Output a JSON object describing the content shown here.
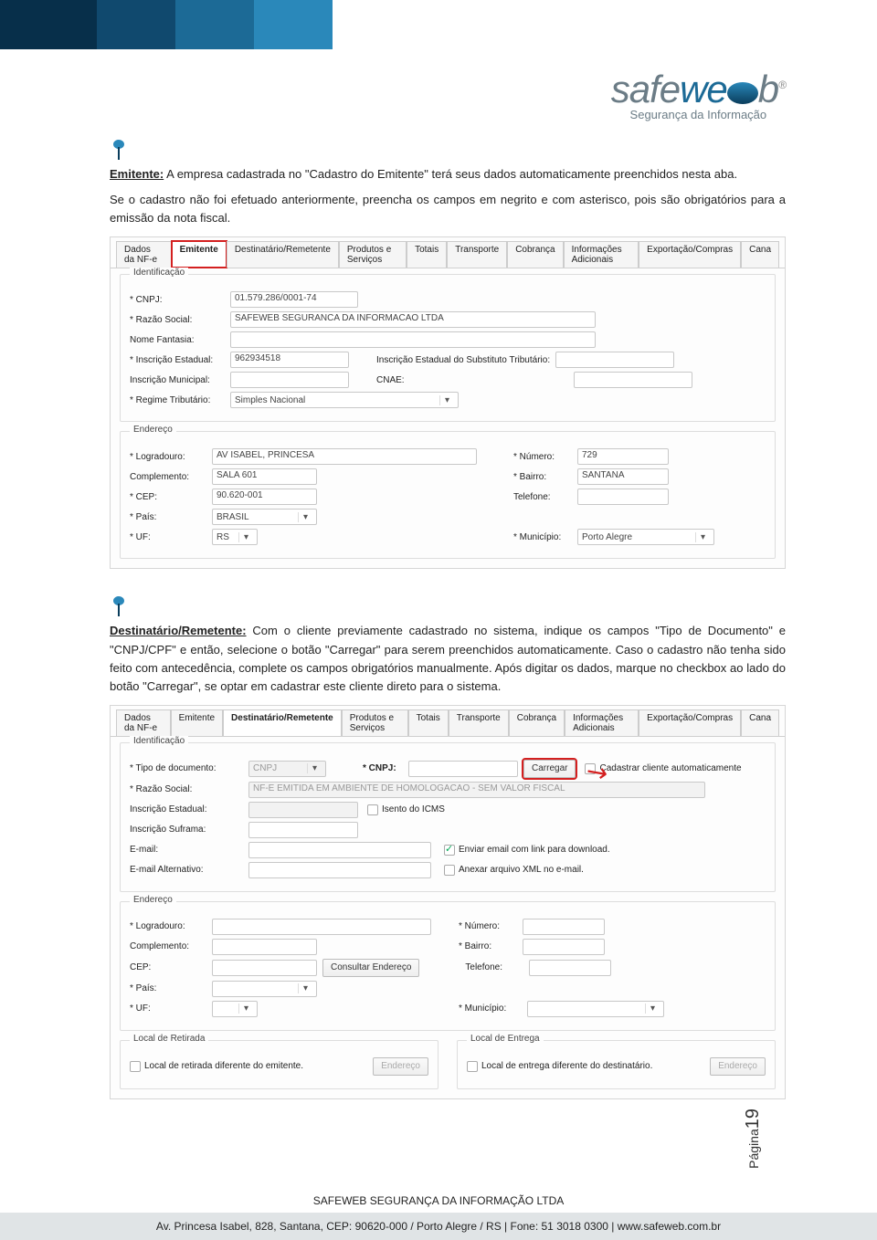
{
  "header": {
    "logo_safe": "safe",
    "logo_we": "we",
    "logo_b": "b",
    "logo_reg": "®",
    "logo_tag": "Segurança da Informação"
  },
  "section1": {
    "title": "Emitente:",
    "text": "A empresa cadastrada no \"Cadastro do Emitente\" terá seus dados automaticamente preenchidos nesta aba.",
    "text2": "Se o cadastro não foi efetuado anteriormente, preencha os campos em negrito e com asterisco, pois são obrigatórios para a emissão da nota fiscal."
  },
  "shot1": {
    "tabs": [
      "Dados da NF-e",
      "Emitente",
      "Destinatário/Remetente",
      "Produtos e Serviços",
      "Totais",
      "Transporte",
      "Cobrança",
      "Informações Adicionais",
      "Exportação/Compras",
      "Cana"
    ],
    "ident_legend": "Identificação",
    "labels": {
      "cnpj": "* CNPJ:",
      "razao": "* Razão Social:",
      "nomefant": "Nome Fantasia:",
      "ie": "* Inscrição Estadual:",
      "ie_sub": "Inscrição Estadual do Substituto Tributário:",
      "im": "Inscrição Municipal:",
      "cnae": "CNAE:",
      "regime": "* Regime Tributário:"
    },
    "values": {
      "cnpj": "01.579.286/0001-74",
      "razao": "SAFEWEB SEGURANCA DA INFORMACAO LTDA",
      "nomefant": "",
      "ie": "962934518",
      "ie_sub": "",
      "im": "",
      "cnae": "",
      "regime": "Simples Nacional"
    },
    "end_legend": "Endereço",
    "end_labels": {
      "logradouro": "* Logradouro:",
      "numero": "* Número:",
      "complemento": "Complemento:",
      "bairro": "* Bairro:",
      "cep": "* CEP:",
      "telefone": "Telefone:",
      "pais": "* País:",
      "uf": "* UF:",
      "municipio": "* Município:"
    },
    "end_values": {
      "logradouro": "AV ISABEL, PRINCESA",
      "numero": "729",
      "complemento": "SALA 601",
      "bairro": "SANTANA",
      "cep": "90.620-001",
      "telefone": "",
      "pais": "BRASIL",
      "uf": "RS",
      "municipio": "Porto Alegre"
    }
  },
  "section2": {
    "title": "Destinatário/Remetente:",
    "text": "Com o cliente previamente cadastrado no sistema, indique os campos \"Tipo de Documento\" e \"CNPJ/CPF\" e então, selecione o botão \"Carregar\" para serem preenchidos automaticamente. Caso o cadastro não tenha sido feito com antecedência, complete os campos obrigatórios manualmente. Após digitar os dados, marque no checkbox ao lado do botão \"Carregar\", se optar em cadastrar este cliente direto para o sistema."
  },
  "shot2": {
    "tabs": [
      "Dados da NF-e",
      "Emitente",
      "Destinatário/Remetente",
      "Produtos e Serviços",
      "Totais",
      "Transporte",
      "Cobrança",
      "Informações Adicionais",
      "Exportação/Compras",
      "Cana"
    ],
    "ident_legend": "Identificação",
    "labels": {
      "tipodoc": "* Tipo de documento:",
      "tipodoc_val": "CNPJ",
      "cnpj": "* CNPJ:",
      "carregar": "Carregar",
      "autocad": "Cadastrar cliente automaticamente",
      "razao": "* Razão Social:",
      "razao_val": "NF-E EMITIDA EM AMBIENTE DE HOMOLOGACAO - SEM VALOR FISCAL",
      "ie": "Inscrição Estadual:",
      "isento": "Isento do ICMS",
      "isuf": "Inscrição Suframa:",
      "email": "E-mail:",
      "emailchk": "Enviar email com link para download.",
      "emailalt": "E-mail Alternativo:",
      "anexar": "Anexar arquivo XML no e-mail."
    },
    "end_legend": "Endereço",
    "end_labels": {
      "logradouro": "* Logradouro:",
      "numero": "* Número:",
      "complemento": "Complemento:",
      "bairro": "* Bairro:",
      "cep": "CEP:",
      "consultar": "Consultar Endereço",
      "telefone": "Telefone:",
      "pais": "* País:",
      "uf": "* UF:",
      "municipio": "* Município:"
    },
    "retirada_legend": "Local de Retirada",
    "retirada_chk": "Local de retirada diferente do emitente.",
    "entrega_legend": "Local de Entrega",
    "entrega_chk": "Local de entrega diferente do destinatário.",
    "endereco_btn": "Endereço"
  },
  "pagenum": {
    "label": "Página",
    "num": "19"
  },
  "footer": {
    "company": "SAFEWEB SEGURANÇA DA INFORMAÇÃO LTDA",
    "addr": "Av. Princesa Isabel, 828, Santana, CEP: 90620-000 / Porto Alegre / RS  |  Fone: 51 3018 0300  |  www.safeweb.com.br"
  }
}
